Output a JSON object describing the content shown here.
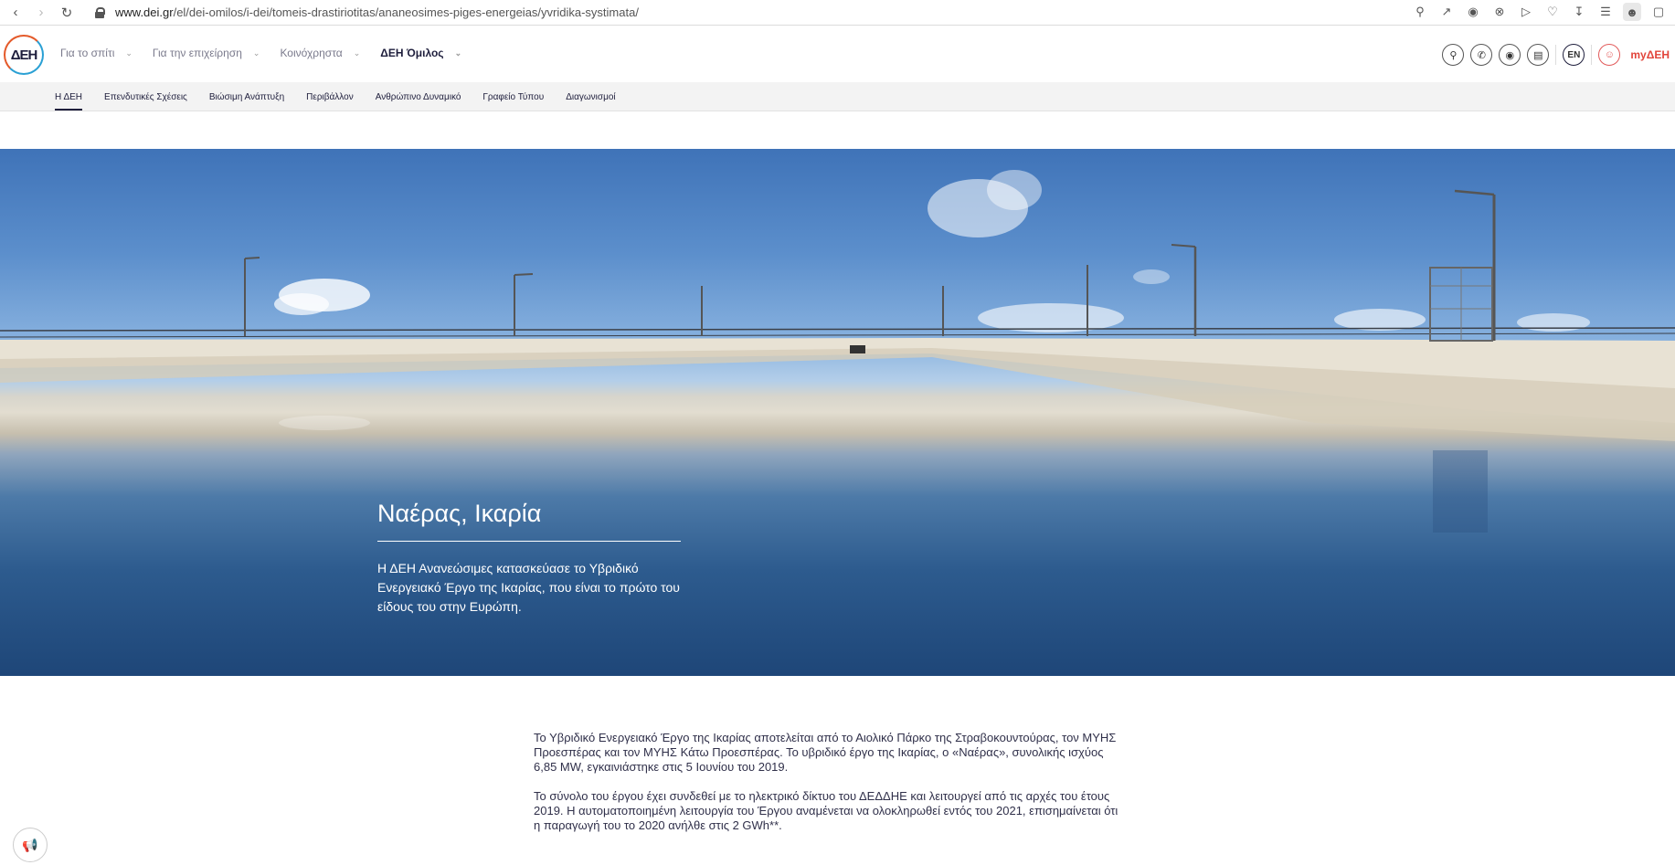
{
  "browser": {
    "url_host": "www.dei.gr",
    "url_path": "/el/dei-omilos/i-dei/tomeis-drastiriotitas/ananeosimes-piges-energeias/yvridika-systimata/"
  },
  "header": {
    "logo_text": "ΔΕΗ",
    "nav": [
      {
        "label": "Για το σπίτι",
        "active": false
      },
      {
        "label": "Για την επιχείρηση",
        "active": false
      },
      {
        "label": "Κοινόχρηστα",
        "active": false
      },
      {
        "label": "ΔΕΗ Όμιλος",
        "active": true
      }
    ],
    "lang": "EN",
    "account_label": "myΔΕΗ"
  },
  "subnav": {
    "items": [
      {
        "label": "Η ΔΕΗ",
        "active": true
      },
      {
        "label": "Επενδυτικές Σχέσεις",
        "active": false
      },
      {
        "label": "Βιώσιμη Ανάπτυξη",
        "active": false
      },
      {
        "label": "Περιβάλλον",
        "active": false
      },
      {
        "label": "Ανθρώπινο Δυναμικό",
        "active": false
      },
      {
        "label": "Γραφείο Τύπου",
        "active": false
      },
      {
        "label": "Διαγωνισμοί",
        "active": false
      }
    ]
  },
  "hero": {
    "title": "Ναέρας, Ικαρία",
    "description": "Η ΔΕΗ Ανανεώσιμες κατασκεύασε το Υβριδικό Ενεργειακό Έργο της Ικαρίας, που είναι το πρώτο του είδους του στην Ευρώπη."
  },
  "content": {
    "paragraphs": [
      "Το Υβριδικό Ενεργειακό Έργο της Ικαρίας αποτελείται από το Αιολικό Πάρκο της Στραβοκουντούρας, τον ΜΥΗΣ Προεσπέρας και τον ΜΥΗΣ Κάτω Προεσπέρας. Το υβριδικό έργο της Ικαρίας, ο «Ναέρας», συνολικής ισχύος 6,85 MW, εγκαινιάστηκε στις 5 Ιουνίου του 2019.",
      "Το σύνολο του έργου έχει συνδεθεί με το ηλεκτρικό δίκτυο του ΔΕΔΔΗΕ και λειτουργεί από τις αρχές του έτους 2019. Η αυτοματοποιημένη λειτουργία του Έργου αναμένεται να ολοκληρωθεί εντός του 2021, επισημαίνεται ότι η παραγωγή του το 2020 ανήλθε στις 2 GWh**."
    ]
  },
  "icons": {
    "back": "arrow-left-icon",
    "forward": "arrow-right-icon",
    "reload": "reload-icon",
    "search": "search-icon",
    "phone": "phone-icon",
    "location": "location-pin-icon",
    "bill": "bill-icon",
    "user": "user-icon",
    "megaphone": "megaphone-icon"
  },
  "colors": {
    "brand_dark": "#1e1e3c",
    "brand_red": "#e2443a",
    "brand_blue": "#2aa0d4"
  }
}
